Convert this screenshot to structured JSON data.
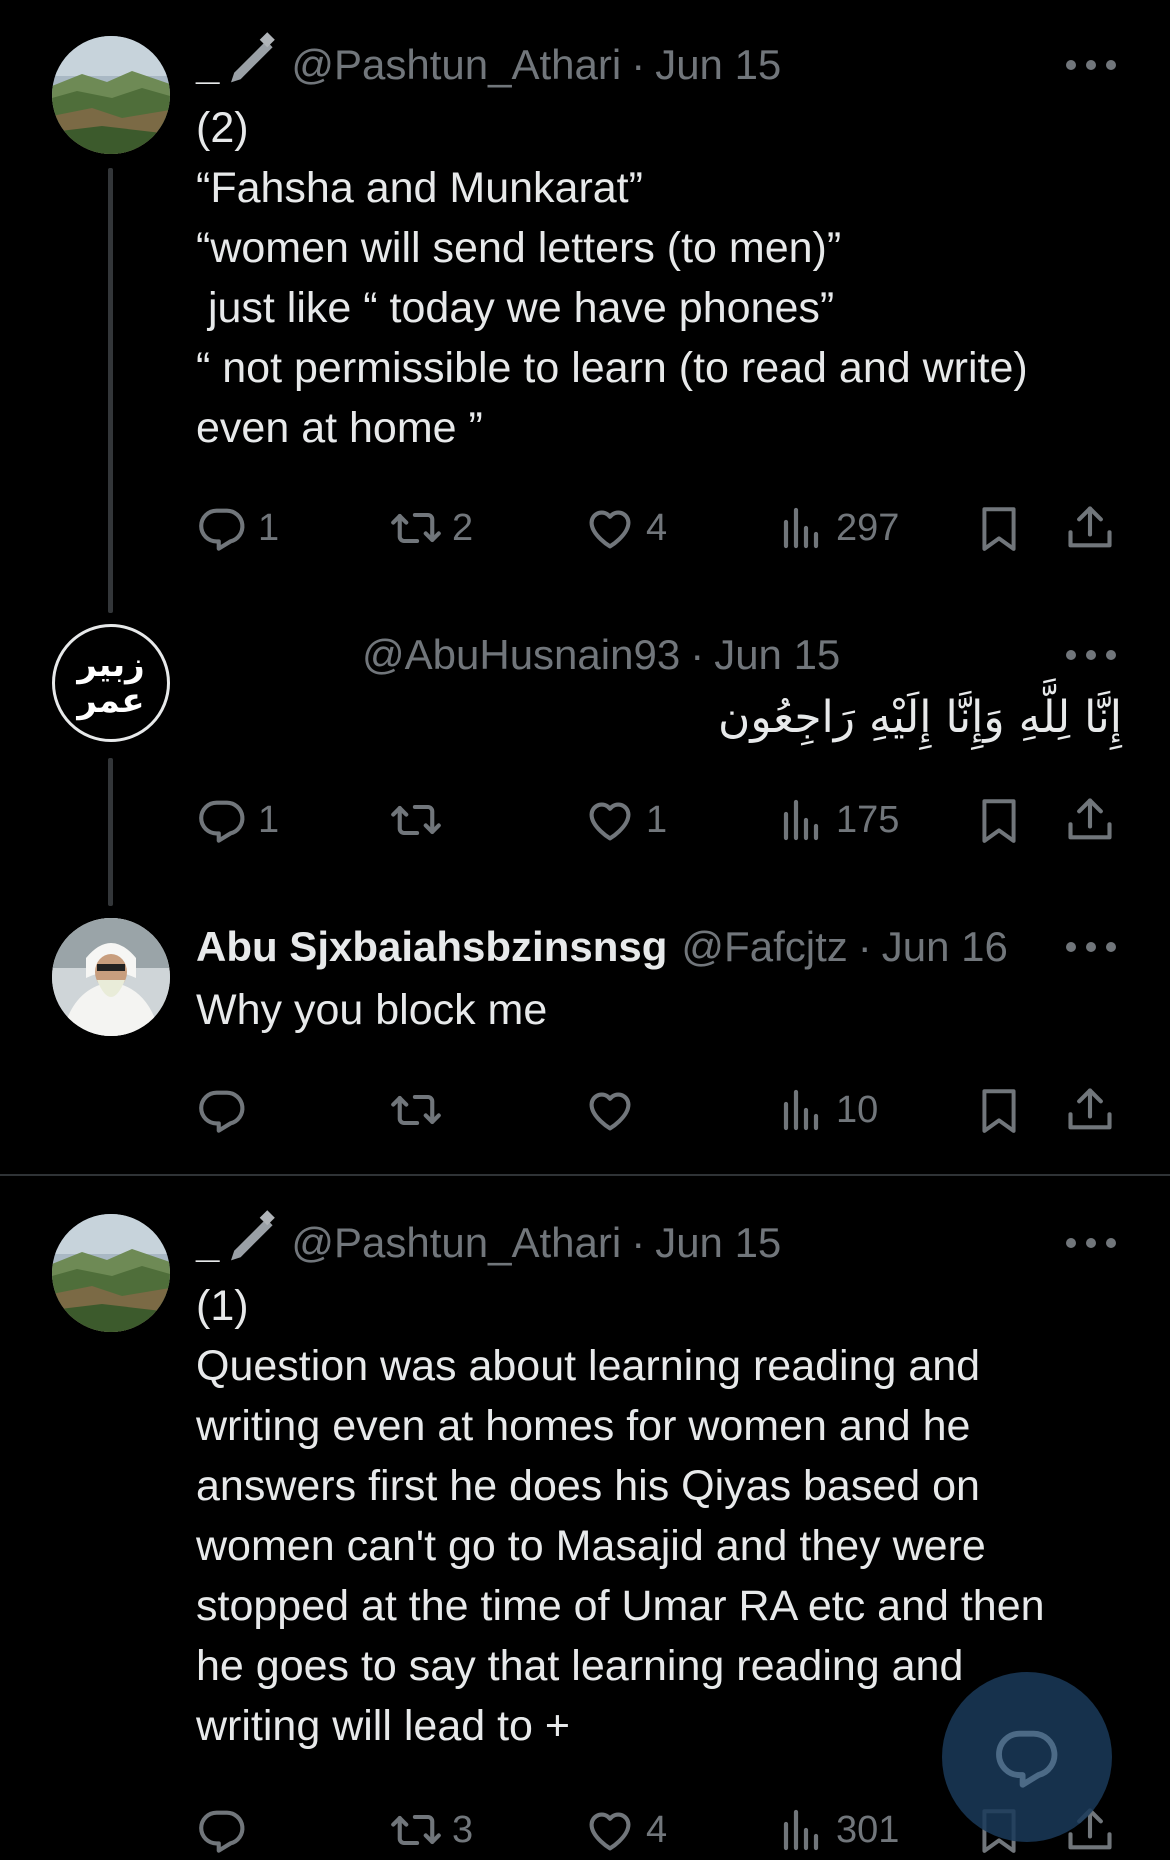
{
  "tweets": [
    {
      "name": "_",
      "handle": "@Pashtun_Athari",
      "dot": "·",
      "date": "Jun 15",
      "lines": [
        "(2)",
        "“Fahsha and Munkarat”",
        "“women will send letters (to men)”",
        " just like “ today we have phones”",
        "“ not permissible to learn (to read and write)",
        "even at home ”"
      ],
      "replies": "1",
      "reposts": "2",
      "likes": "4",
      "views": "297"
    },
    {
      "name": "",
      "handle": "@AbuHusnain93",
      "dot": "·",
      "date": "Jun 15",
      "text": "إِنَّا لِلَّهِ وَإِنَّا إِلَيْهِ رَاجِعُون",
      "avatar_text_top": "زبير",
      "avatar_text_bottom": "عمر",
      "replies": "1",
      "reposts": "",
      "likes": "1",
      "views": "175"
    },
    {
      "name": "Abu Sjxbaiahsbzinsnsg",
      "handle": "@Fafcjtz",
      "dot": "·",
      "date": "Jun 16",
      "text": "Why you block me",
      "replies": "",
      "reposts": "",
      "likes": "",
      "views": "10"
    },
    {
      "name": "_",
      "handle": "@Pashtun_Athari",
      "dot": "·",
      "date": "Jun 15",
      "lines": [
        "(1)",
        "Question was about learning reading and",
        "writing even at homes for women and he",
        "answers first he does his Qiyas based on",
        "women can't go to Masajid and they were",
        "stopped at the time of Umar RA etc and then",
        "he goes to say that learning reading and",
        "writing will lead to +"
      ],
      "replies": "",
      "reposts": "3",
      "likes": "4",
      "views": "301"
    }
  ],
  "icons": {
    "reply": "reply-icon",
    "repost": "repost-icon",
    "like": "heart-icon",
    "views": "views-icon",
    "bookmark": "bookmark-icon",
    "share": "share-icon",
    "more": "more-icon",
    "pen": "pen-icon",
    "compose": "compose-icon"
  },
  "colors": {
    "background": "#000000",
    "text": "#e7e9ea",
    "muted": "#71767b",
    "fab": "#1a3a5a"
  }
}
